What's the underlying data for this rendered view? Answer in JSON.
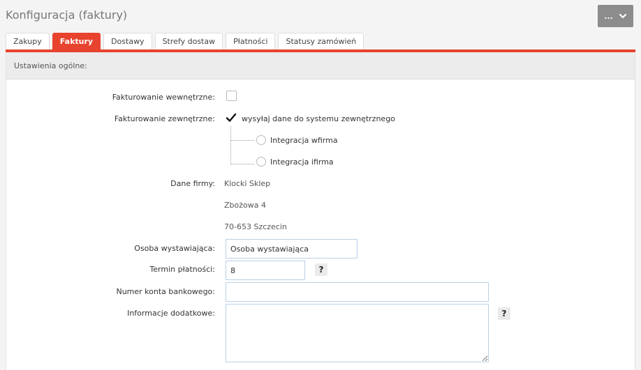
{
  "header": {
    "title": "Konfiguracja (faktury)",
    "more_label": "...",
    "more_icon": "chevron-down-icon"
  },
  "tabs": [
    {
      "label": "Zakupy",
      "active": false
    },
    {
      "label": "Faktury",
      "active": true
    },
    {
      "label": "Dostawy",
      "active": false
    },
    {
      "label": "Strefy dostaw",
      "active": false
    },
    {
      "label": "Płatności",
      "active": false
    },
    {
      "label": "Statusy zamówień",
      "active": false
    }
  ],
  "colors": {
    "accent": "#e8432e",
    "button_bg": "#8c8c8c",
    "input_border": "#b9d0e6"
  },
  "section": {
    "title": "Ustawienia ogólne:"
  },
  "form": {
    "internal_invoicing": {
      "label": "Fakturowanie wewnętrzne:",
      "checked": false
    },
    "external_invoicing": {
      "label": "Fakturowanie zewnętrzne:",
      "checked": true,
      "checkbox_text": "wysyłaj dane do systemu zewnętrznego",
      "options": [
        {
          "label": "Integracja wfirma",
          "selected": false
        },
        {
          "label": "Integracja ifirma",
          "selected": false
        }
      ]
    },
    "company": {
      "label": "Dane firmy:",
      "lines": [
        "Klocki Sklep",
        "Zbożowa 4",
        "70-653 Szczecin"
      ]
    },
    "issuer": {
      "label": "Osoba wystawiająca:",
      "value": "Osoba wystawiająca"
    },
    "payment_term": {
      "label": "Termin płatności:",
      "value": "8",
      "help": "?"
    },
    "bank_account": {
      "label": "Numer konta bankowego:",
      "value": ""
    },
    "additional_info": {
      "label": "Informacje dodatkowe:",
      "value": "",
      "help": "?"
    }
  }
}
